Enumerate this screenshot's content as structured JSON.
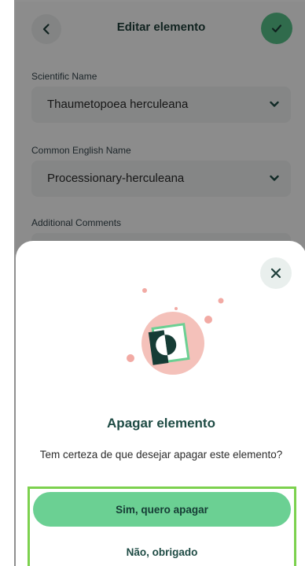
{
  "header": {
    "title": "Editar elemento",
    "back_icon": "chevron-left-icon",
    "confirm_icon": "check-icon"
  },
  "form": {
    "fields": [
      {
        "label": "Scientific Name",
        "value": "Thaumetopoea herculeana"
      },
      {
        "label": "Common English Name",
        "value": "Processionary-herculeana"
      },
      {
        "label": "Additional Comments",
        "value": ""
      }
    ]
  },
  "dialog": {
    "close_icon": "close-icon",
    "illustration": "delete-document-illustration",
    "title": "Apagar elemento",
    "message": "Tem certeza de que desejar apagar este elemento?",
    "confirm_label": "Sim, quero apagar",
    "cancel_label": "Não, obrigado"
  },
  "colors": {
    "accent": "#58c48a",
    "primary_button": "#6bd093",
    "title_text": "#1e4b44",
    "highlight_border": "#7cd14e"
  }
}
